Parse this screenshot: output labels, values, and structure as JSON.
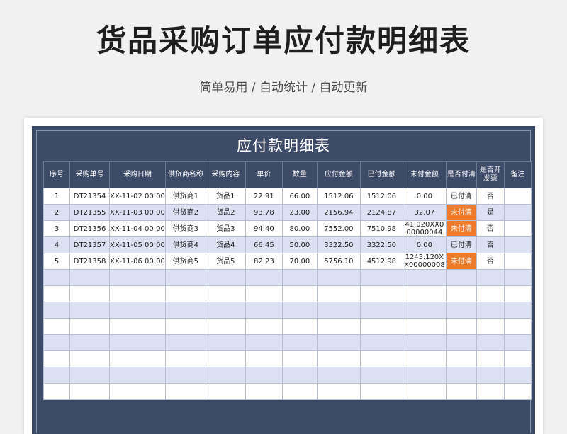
{
  "header": {
    "title": "货品采购订单应付款明细表",
    "subtitle": "简单易用  /  自动统计  /  自动更新"
  },
  "sheet": {
    "title": "应付款明细表",
    "columns": [
      "序号",
      "采购单号",
      "采购日期",
      "供货商名称",
      "采购内容",
      "单价",
      "数量",
      "应付金额",
      "已付金额",
      "未付金额",
      "是否付清",
      "是否开发票",
      "备注"
    ],
    "rows": [
      [
        "1",
        "DT21354",
        "XX-11-02 00:00",
        "供货商1",
        "货品1",
        "22.91",
        "66.00",
        "1512.06",
        "1512.06",
        "0.00",
        "已付清",
        "否",
        ""
      ],
      [
        "2",
        "DT21355",
        "XX-11-03 00:00",
        "供货商2",
        "货品2",
        "93.78",
        "23.00",
        "2156.94",
        "2124.87",
        "32.07",
        "未付清",
        "是",
        ""
      ],
      [
        "3",
        "DT21356",
        "XX-11-04 00:00",
        "供货商3",
        "货品3",
        "94.40",
        "80.00",
        "7552.00",
        "7510.98",
        "41.020XX000000044",
        "未付清",
        "否",
        ""
      ],
      [
        "4",
        "DT21357",
        "XX-11-05 00:00",
        "供货商4",
        "货品4",
        "66.45",
        "50.00",
        "3322.50",
        "3322.50",
        "0.00",
        "已付清",
        "否",
        ""
      ],
      [
        "5",
        "DT21358",
        "XX-11-06 00:00",
        "供货商5",
        "货品5",
        "82.23",
        "70.00",
        "5756.10",
        "4512.98",
        "1243.120XX00000008",
        "未付清",
        "否",
        ""
      ]
    ],
    "empty_rows": 8,
    "colors": {
      "header_bg": "#3d4a68",
      "stripe": "#dbe0f3",
      "unpaid": "#ef7b2b"
    }
  }
}
